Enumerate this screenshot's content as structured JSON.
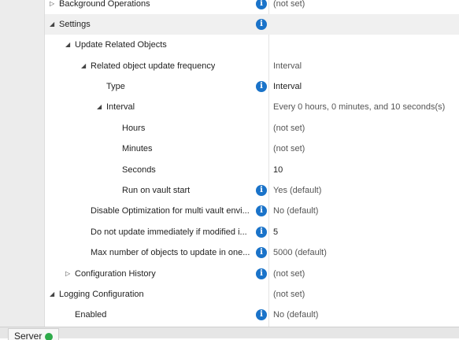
{
  "rows": [
    {
      "label": "Background Operations",
      "value": "(not set)",
      "expander": "▷",
      "info": true
    },
    {
      "label": "Settings",
      "value": "",
      "expander": "◢",
      "info": true
    },
    {
      "label": "Update Related Objects",
      "value": "",
      "expander": "◢",
      "info": false
    },
    {
      "label": "Related object update frequency",
      "value": "Interval",
      "expander": "◢",
      "info": false
    },
    {
      "label": "Type",
      "value": "Interval",
      "expander": "",
      "info": true
    },
    {
      "label": "Interval",
      "value": "Every 0 hours, 0 minutes, and 10 seconds(s)",
      "expander": "◢",
      "info": false
    },
    {
      "label": "Hours",
      "value": "(not set)",
      "expander": "",
      "info": false
    },
    {
      "label": "Minutes",
      "value": "(not set)",
      "expander": "",
      "info": false
    },
    {
      "label": "Seconds",
      "value": "10",
      "expander": "",
      "info": false
    },
    {
      "label": "Run on vault start",
      "value": "Yes (default)",
      "expander": "",
      "info": true
    },
    {
      "label": "Disable Optimization for multi vault envi...",
      "value": "No (default)",
      "expander": "",
      "info": true
    },
    {
      "label": "Do not update immediately if modified i...",
      "value": "5",
      "expander": "",
      "info": true
    },
    {
      "label": "Max number of objects to update in one...",
      "value": "5000 (default)",
      "expander": "",
      "info": true
    },
    {
      "label": "Configuration History",
      "value": "(not set)",
      "expander": "▷",
      "info": true
    },
    {
      "label": "Logging Configuration",
      "value": "(not set)",
      "expander": "◢",
      "info": false
    },
    {
      "label": "Enabled",
      "value": "No (default)",
      "expander": "",
      "info": true
    }
  ],
  "info_glyph": "i",
  "info_icon_color": "#1a73c9",
  "statusbar": {
    "server_label": "Server",
    "status_color": "#2eaa4a"
  }
}
